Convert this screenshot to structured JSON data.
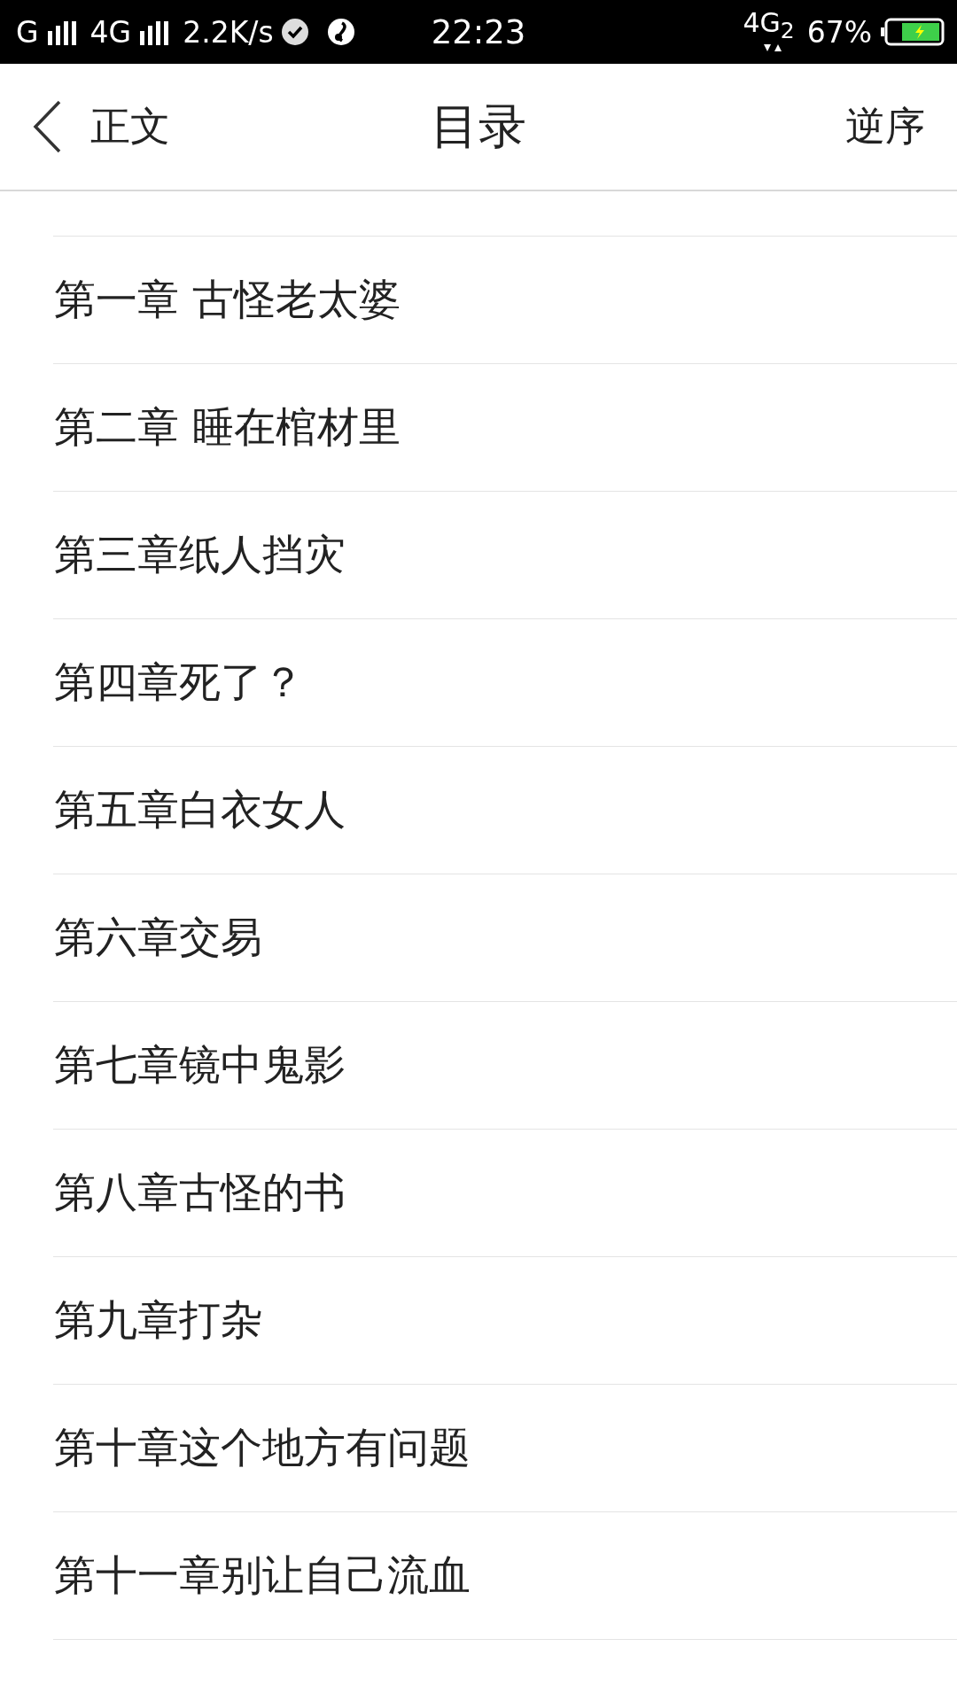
{
  "status_bar": {
    "carrier_1": "G",
    "carrier_2": "4G",
    "speed": "2.2K/s",
    "time": "22:23",
    "network": "4G$_{2}$",
    "battery": "67%"
  },
  "header": {
    "back_label": "正文",
    "title": "目录",
    "action": "逆序"
  },
  "chapters": [
    {
      "title": "第一章 古怪老太婆"
    },
    {
      "title": "第二章 睡在棺材里"
    },
    {
      "title": "第三章纸人挡灾"
    },
    {
      "title": "第四章死了？"
    },
    {
      "title": "第五章白衣女人"
    },
    {
      "title": "第六章交易"
    },
    {
      "title": "第七章镜中鬼影"
    },
    {
      "title": "第八章古怪的书"
    },
    {
      "title": "第九章打杂"
    },
    {
      "title": "第十章这个地方有问题"
    },
    {
      "title": "第十一章别让自己流血"
    }
  ]
}
